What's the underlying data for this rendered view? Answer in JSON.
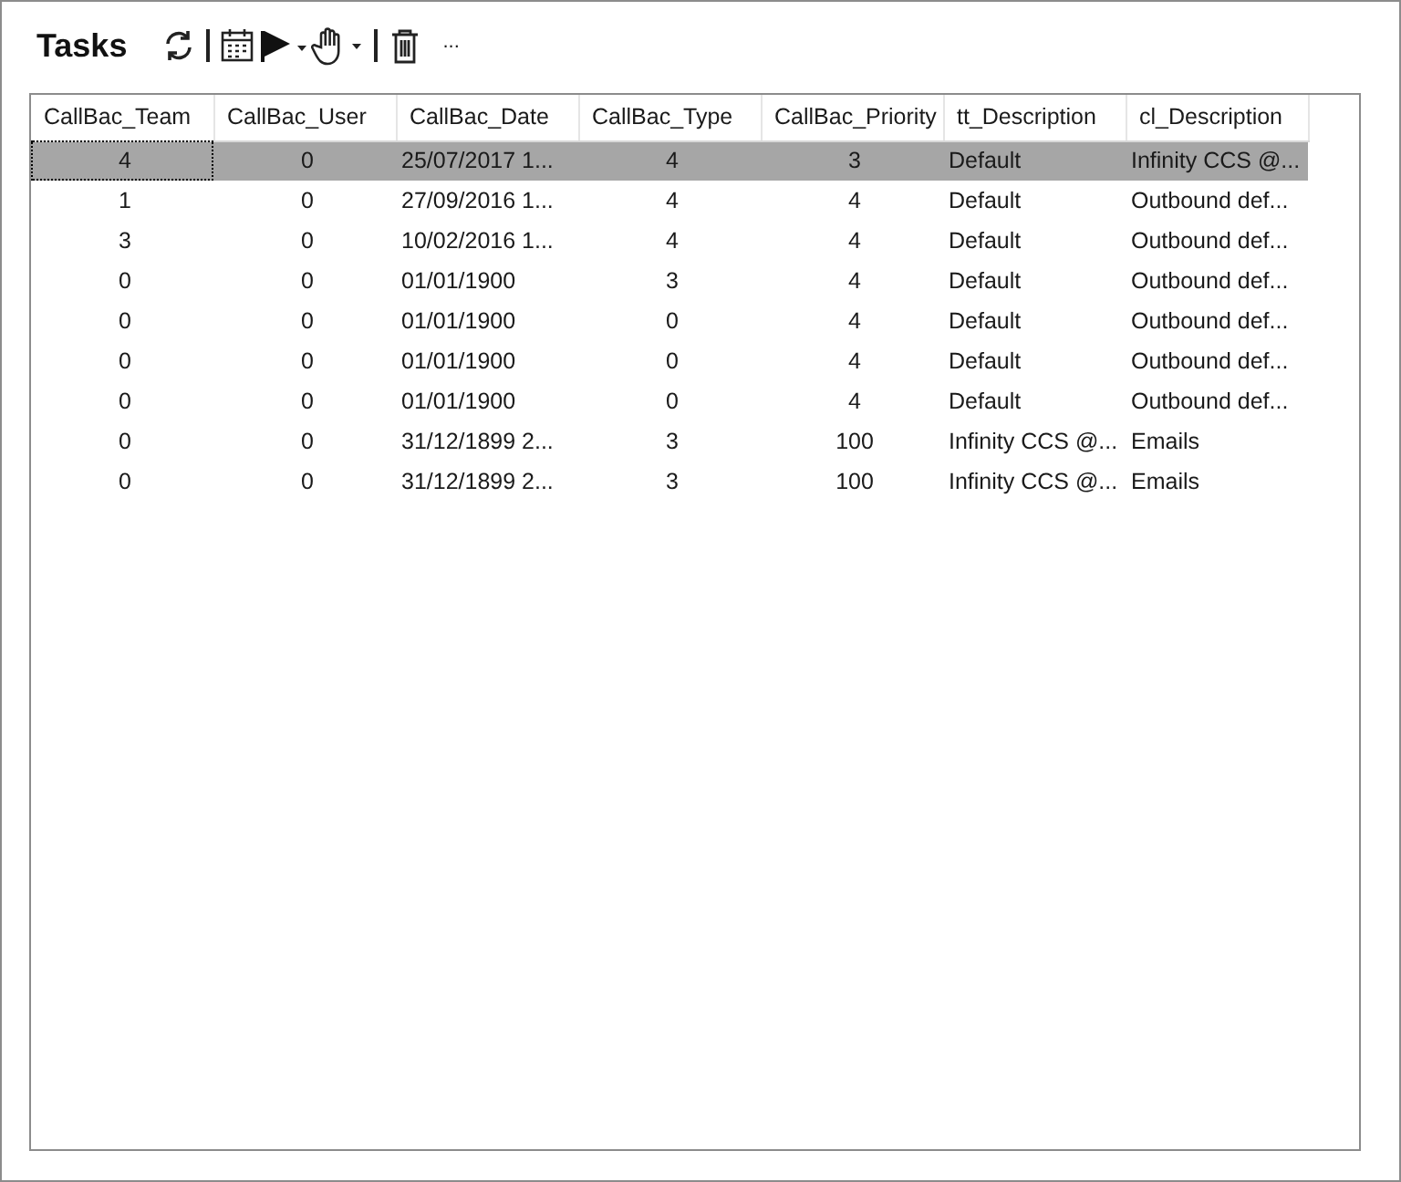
{
  "title": "Tasks",
  "toolbar": {
    "more": "..."
  },
  "table": {
    "columns": [
      {
        "label": "CallBac_Team",
        "kind": "number"
      },
      {
        "label": "CallBac_User",
        "kind": "number"
      },
      {
        "label": "CallBac_Date",
        "kind": "text"
      },
      {
        "label": "CallBac_Type",
        "kind": "number"
      },
      {
        "label": "CallBac_Priority",
        "kind": "number"
      },
      {
        "label": "tt_Description",
        "kind": "text"
      },
      {
        "label": "cl_Description",
        "kind": "text"
      }
    ],
    "rows": [
      {
        "selected": true,
        "cells": [
          "4",
          "0",
          "25/07/2017 1...",
          "4",
          "3",
          "Default",
          "Infinity CCS @..."
        ]
      },
      {
        "selected": false,
        "cells": [
          "1",
          "0",
          "27/09/2016 1...",
          "4",
          "4",
          "Default",
          "Outbound def..."
        ]
      },
      {
        "selected": false,
        "cells": [
          "3",
          "0",
          "10/02/2016 1...",
          "4",
          "4",
          "Default",
          "Outbound def..."
        ]
      },
      {
        "selected": false,
        "cells": [
          "0",
          "0",
          "01/01/1900",
          "3",
          "4",
          "Default",
          "Outbound def..."
        ]
      },
      {
        "selected": false,
        "cells": [
          "0",
          "0",
          "01/01/1900",
          "0",
          "4",
          "Default",
          "Outbound def..."
        ]
      },
      {
        "selected": false,
        "cells": [
          "0",
          "0",
          "01/01/1900",
          "0",
          "4",
          "Default",
          "Outbound def..."
        ]
      },
      {
        "selected": false,
        "cells": [
          "0",
          "0",
          "01/01/1900",
          "0",
          "4",
          "Default",
          "Outbound def..."
        ]
      },
      {
        "selected": false,
        "cells": [
          "0",
          "0",
          "31/12/1899 2...",
          "3",
          "100",
          "Infinity CCS @...",
          "Emails"
        ]
      },
      {
        "selected": false,
        "cells": [
          "0",
          "0",
          "31/12/1899 2...",
          "3",
          "100",
          "Infinity CCS @...",
          "Emails"
        ]
      }
    ]
  }
}
